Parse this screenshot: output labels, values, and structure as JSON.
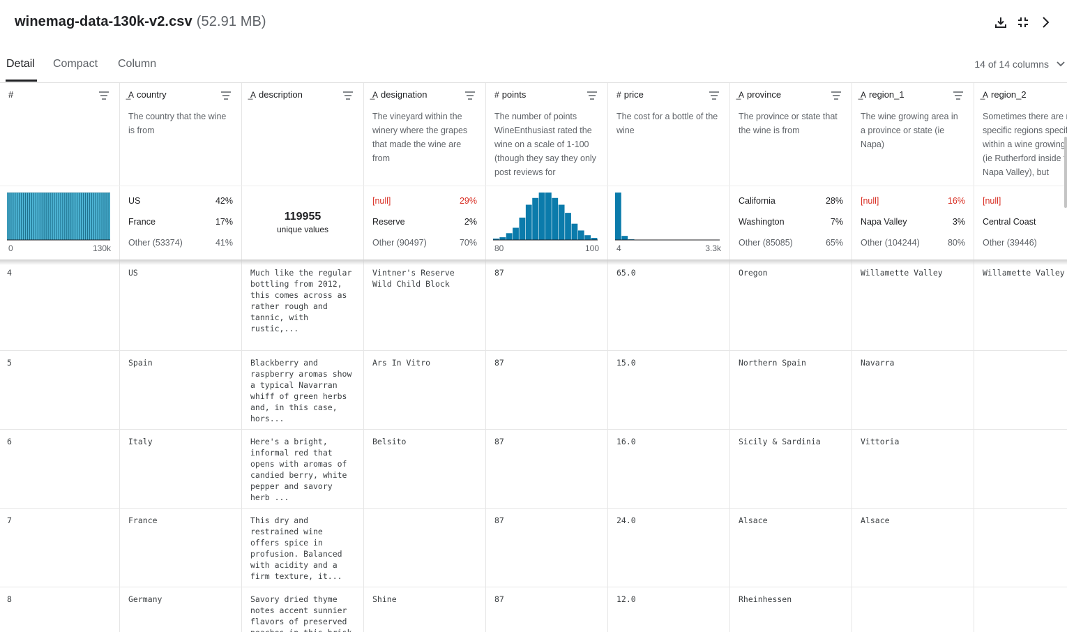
{
  "file": {
    "name": "winemag-data-130k-v2.csv",
    "size": "(52.91 MB)"
  },
  "tabs": [
    "Detail",
    "Compact",
    "Column"
  ],
  "column_count": "14 of 14 columns",
  "columns": [
    {
      "type": "#",
      "name": "",
      "desc": ""
    },
    {
      "type": "A",
      "name": "country",
      "desc": "The country that the wine is from"
    },
    {
      "type": "A",
      "name": "description",
      "desc": ""
    },
    {
      "type": "A",
      "name": "designation",
      "desc": "The vineyard within the winery where the grapes that made the wine are from"
    },
    {
      "type": "#",
      "name": "points",
      "desc": "The number of points WineEnthusiast rated the wine on a scale of 1-100 (though they say they only post reviews for"
    },
    {
      "type": "#",
      "name": "price",
      "desc": "The cost for a bottle of the wine"
    },
    {
      "type": "A",
      "name": "province",
      "desc": "The province or state that the wine is from"
    },
    {
      "type": "A",
      "name": "region_1",
      "desc": "The wine growing area in a province or state (ie Napa)"
    },
    {
      "type": "A",
      "name": "region_2",
      "desc": "Sometimes there are more specific regions specified within a wine growing area (ie Rutherford inside the Napa Valley), but"
    }
  ],
  "stats": {
    "index": {
      "axis_min": "0",
      "axis_max": "130k"
    },
    "country": [
      [
        "US",
        "42%"
      ],
      [
        "France",
        "17%"
      ],
      [
        "Other (53374)",
        "41%"
      ]
    ],
    "description": {
      "count": "119955",
      "label": "unique values"
    },
    "designation": [
      [
        "[null]",
        "29%"
      ],
      [
        "Reserve",
        "2%"
      ],
      [
        "Other (90497)",
        "70%"
      ]
    ],
    "points": {
      "axis_min": "80",
      "axis_max": "100"
    },
    "price": {
      "axis_min": "4",
      "axis_max": "3.3k"
    },
    "province": [
      [
        "California",
        "28%"
      ],
      [
        "Washington",
        "7%"
      ],
      [
        "Other (85085)",
        "65%"
      ]
    ],
    "region_1": [
      [
        "[null]",
        "16%"
      ],
      [
        "Napa Valley",
        "3%"
      ],
      [
        "Other (104244)",
        "80%"
      ]
    ],
    "region_2": [
      [
        "[null]",
        ""
      ],
      [
        "Central Coast",
        ""
      ],
      [
        "Other (39446)",
        ""
      ]
    ]
  },
  "chart_data": [
    {
      "type": "bar",
      "title": "",
      "x_range": [
        0,
        130000
      ],
      "values": [
        1,
        1,
        1,
        1,
        1,
        1,
        1,
        1,
        1,
        1,
        1,
        1,
        1,
        1,
        1,
        1,
        1,
        1,
        1,
        1,
        1,
        1,
        1,
        1,
        1,
        1,
        1,
        1,
        1,
        1,
        1,
        1,
        1,
        1,
        1,
        1,
        1,
        1,
        1,
        1,
        1,
        1,
        1,
        1,
        1,
        1,
        1,
        1,
        1,
        1
      ]
    },
    {
      "type": "bar",
      "title": "",
      "x_range": [
        80,
        100
      ],
      "values": [
        2,
        4,
        10,
        18,
        33,
        52,
        62,
        70,
        70,
        62,
        52,
        40,
        24,
        14,
        7,
        3
      ]
    },
    {
      "type": "bar",
      "title": "",
      "x_range": [
        4,
        3300
      ],
      "values": [
        70,
        6,
        1,
        0,
        0,
        0,
        0,
        0,
        0,
        0,
        0,
        0,
        0,
        0,
        0,
        0
      ]
    }
  ],
  "rows": [
    {
      "idx": "4",
      "country": "US",
      "description": "Much like the regular bottling from 2012, this comes across as rather rough and tannic, with rustic,...",
      "designation": "Vintner's Reserve Wild Child Block",
      "points": "87",
      "price": "65.0",
      "province": "Oregon",
      "region_1": "Willamette Valley",
      "region_2": "Willamette Valley"
    },
    {
      "idx": "5",
      "country": "Spain",
      "description": "Blackberry and raspberry aromas show a typical Navarran whiff of green herbs and, in this case, hors...",
      "designation": "Ars In Vitro",
      "points": "87",
      "price": "15.0",
      "province": "Northern Spain",
      "region_1": "Navarra",
      "region_2": ""
    },
    {
      "idx": "6",
      "country": "Italy",
      "description": "Here's a bright, informal red that opens with aromas of candied berry, white pepper and savory herb ...",
      "designation": "Belsito",
      "points": "87",
      "price": "16.0",
      "province": "Sicily & Sardinia",
      "region_1": "Vittoria",
      "region_2": ""
    },
    {
      "idx": "7",
      "country": "France",
      "description": "This dry and restrained wine offers spice in profusion. Balanced with acidity and a firm texture, it...",
      "designation": "",
      "points": "87",
      "price": "24.0",
      "province": "Alsace",
      "region_1": "Alsace",
      "region_2": ""
    },
    {
      "idx": "8",
      "country": "Germany",
      "description": "Savory dried thyme notes accent sunnier flavors of preserved peaches in this brisk",
      "designation": "Shine",
      "points": "87",
      "price": "12.0",
      "province": "Rheinhessen",
      "region_1": "",
      "region_2": ""
    }
  ]
}
